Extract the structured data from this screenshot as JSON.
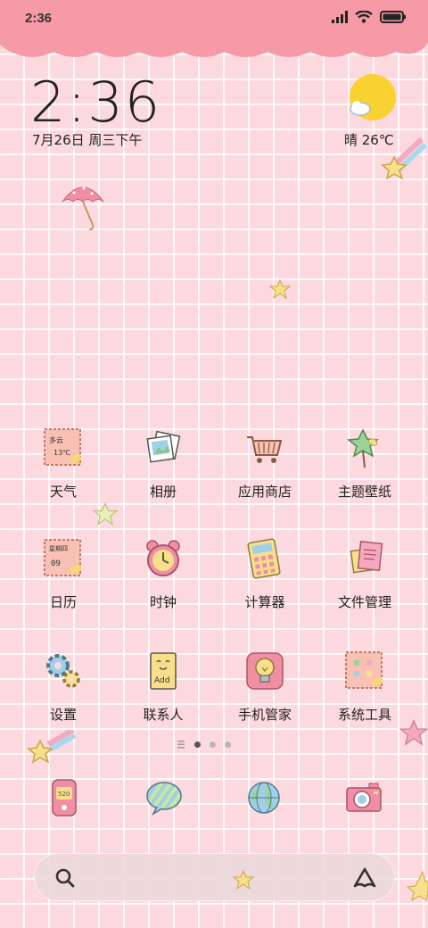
{
  "status_bar": {
    "time": "2:36"
  },
  "clock_widget": {
    "time": "2:36",
    "date": "7月26日 周三下午"
  },
  "weather_widget": {
    "text": "晴 26℃"
  },
  "icon_text": {
    "weather_line1": "多云",
    "weather_line2": "13℃",
    "calendar_line1": "星期四",
    "calendar_line2": "09",
    "contacts_text": "Add",
    "dock_phone_text": "520"
  },
  "apps": [
    {
      "label": "天气",
      "icon": "weather-icon"
    },
    {
      "label": "相册",
      "icon": "gallery-icon"
    },
    {
      "label": "应用商店",
      "icon": "app-store-icon"
    },
    {
      "label": "主题壁纸",
      "icon": "themes-icon"
    },
    {
      "label": "日历",
      "icon": "calendar-icon"
    },
    {
      "label": "时钟",
      "icon": "clock-icon"
    },
    {
      "label": "计算器",
      "icon": "calculator-icon"
    },
    {
      "label": "文件管理",
      "icon": "file-manager-icon"
    },
    {
      "label": "设置",
      "icon": "settings-icon"
    },
    {
      "label": "联系人",
      "icon": "contacts-icon"
    },
    {
      "label": "手机管家",
      "icon": "security-icon"
    },
    {
      "label": "系统工具",
      "icon": "system-tools-icon"
    }
  ],
  "page_indicator": {
    "pages": 3,
    "current": 1
  },
  "dock": [
    {
      "icon": "phone-icon"
    },
    {
      "icon": "messages-icon"
    },
    {
      "icon": "browser-icon"
    },
    {
      "icon": "camera-icon"
    }
  ],
  "colors": {
    "header_pink": "#f69aa8",
    "background_pink": "#fcd9de",
    "sun_yellow": "#f9d232"
  }
}
